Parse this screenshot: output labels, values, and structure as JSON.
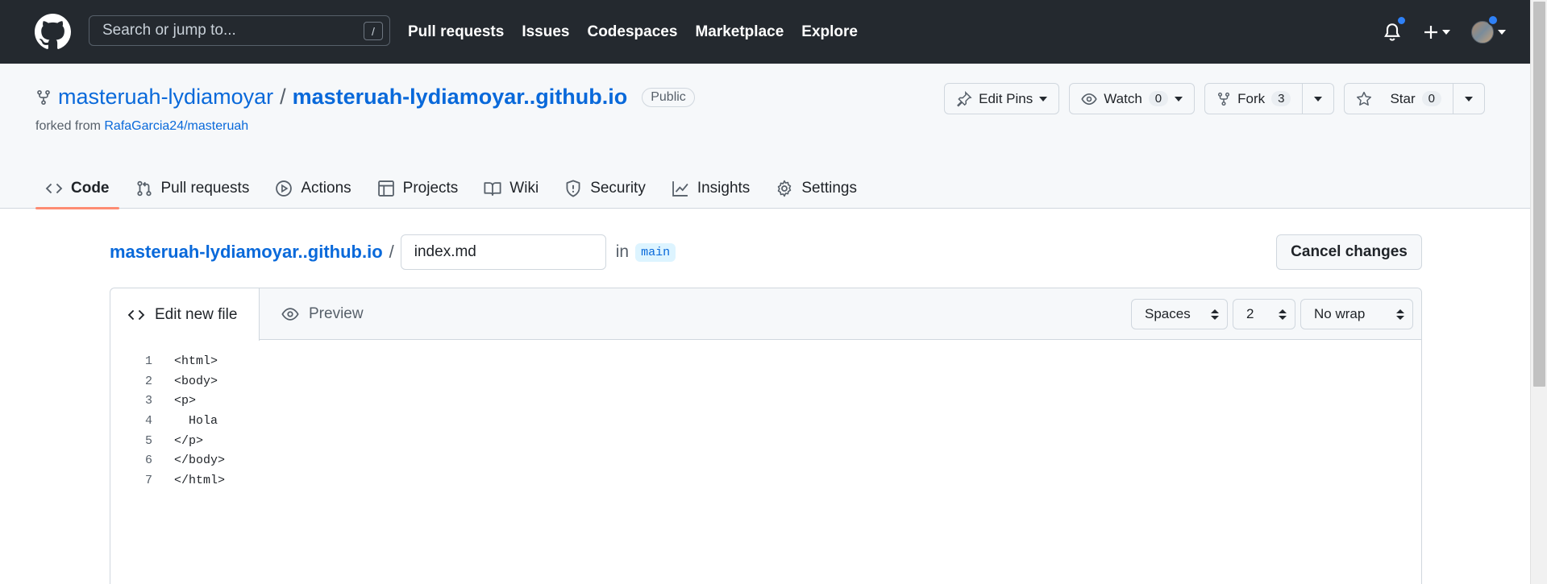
{
  "header": {
    "search_placeholder": "Search or jump to...",
    "search_shortcut": "/",
    "nav": [
      "Pull requests",
      "Issues",
      "Codespaces",
      "Marketplace",
      "Explore"
    ]
  },
  "repo": {
    "owner": "masteruah-lydiamoyar",
    "separator": "/",
    "name": "masteruah-lydiamoyar..github.io",
    "visibility": "Public",
    "forked_prefix": "forked from",
    "forked_source": "RafaGarcia24/masteruah",
    "actions": {
      "edit_pins": "Edit Pins",
      "watch": "Watch",
      "watch_count": "0",
      "fork": "Fork",
      "fork_count": "3",
      "star": "Star",
      "star_count": "0"
    },
    "tabs": [
      "Code",
      "Pull requests",
      "Actions",
      "Projects",
      "Wiki",
      "Security",
      "Insights",
      "Settings"
    ]
  },
  "editor": {
    "repo_link": "masteruah-lydiamoyar..github.io",
    "path_sep": "/",
    "filename": "index.md",
    "in_label": "in",
    "branch": "main",
    "cancel": "Cancel changes",
    "tab_edit": "Edit new file",
    "tab_preview": "Preview",
    "indent_mode": "Spaces",
    "indent_size": "2",
    "wrap_mode": "No wrap",
    "lines": [
      "<html>",
      "<body>",
      "<p>",
      "  Hola",
      "</p>",
      "</body>",
      "</html>"
    ]
  },
  "colors": {
    "header_bg": "#24292f",
    "link": "#0969da",
    "tab_underline": "#fd8c73",
    "notification_dot": "#2f81f7"
  },
  "icons": [
    "github-logo-icon",
    "bell-icon",
    "plus-icon",
    "repo-forked-icon",
    "pin-icon",
    "eye-icon",
    "star-icon",
    "code-icon",
    "git-pull-request-icon",
    "play-icon",
    "table-icon",
    "book-icon",
    "shield-icon",
    "graph-icon",
    "gear-icon"
  ]
}
